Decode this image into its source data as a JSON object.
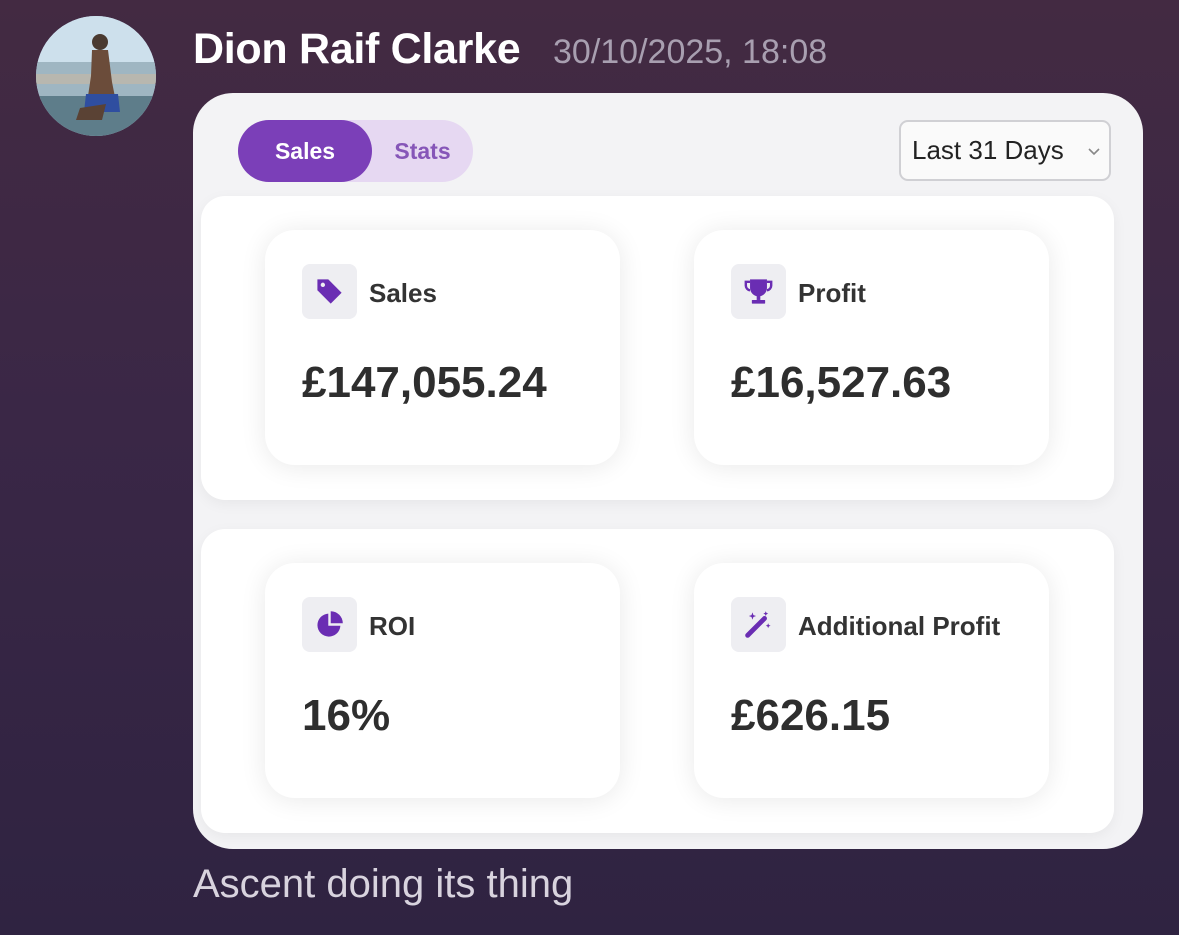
{
  "message": {
    "author": "Dion Raif Clarke",
    "timestamp": "30/10/2025, 18:08",
    "caption": "Ascent doing its thing"
  },
  "card": {
    "tabs": [
      {
        "label": "Sales",
        "active": true
      },
      {
        "label": "Stats",
        "active": false
      }
    ],
    "range_select": {
      "value": "Last 31 Days"
    },
    "stats": [
      {
        "label": "Sales",
        "value": "£147,055.24",
        "icon": "tag-icon"
      },
      {
        "label": "Profit",
        "value": "£16,527.63",
        "icon": "trophy-icon"
      },
      {
        "label": "ROI",
        "value": "16%",
        "icon": "pie-chart-icon"
      },
      {
        "label": "Additional Profit",
        "value": "£626.15",
        "icon": "magic-wand-icon"
      }
    ]
  },
  "colors": {
    "accent": "#7b3fb8",
    "icon": "#6a2db3",
    "background": "#3a2746"
  }
}
